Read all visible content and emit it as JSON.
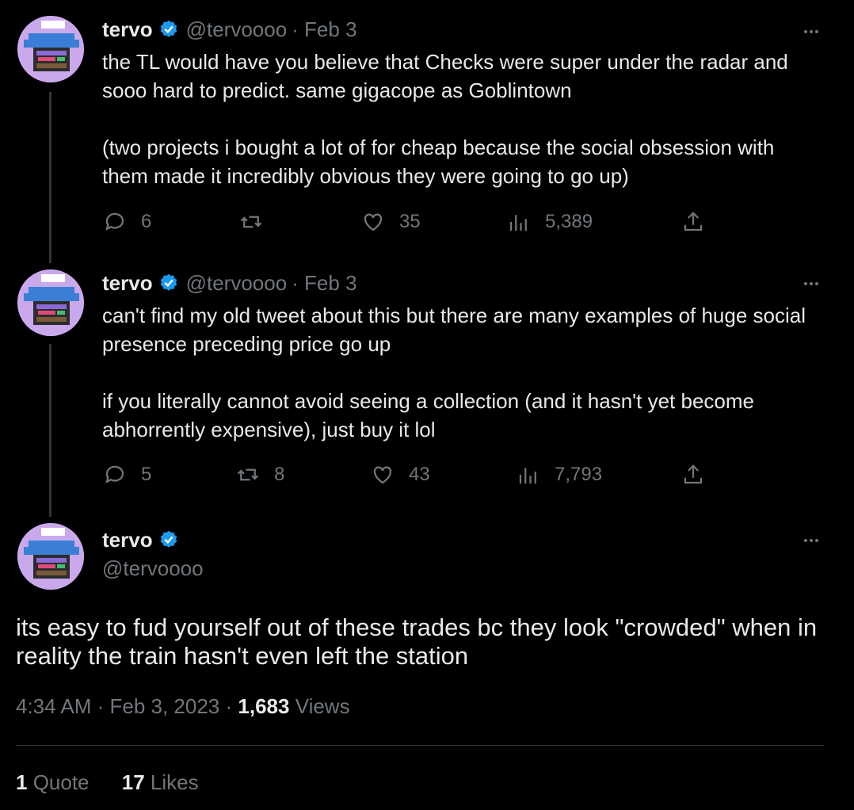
{
  "tweets": [
    {
      "name": "tervo",
      "handle": "@tervoooo",
      "date": "· Feb 3",
      "paragraphs": [
        "the TL would have you believe that Checks were super under the radar and sooo hard to predict. same gigacope as Goblintown",
        "(two projects i bought a lot of for cheap because the social obsession with them made it incredibly obvious they were going to go up)"
      ],
      "replies": "6",
      "retweets": "",
      "likes": "35",
      "views": "5,389"
    },
    {
      "name": "tervo",
      "handle": "@tervoooo",
      "date": "· Feb 3",
      "paragraphs": [
        "can't find my old tweet about this but there are many examples of huge social presence preceding price go up",
        "if you literally cannot avoid seeing a collection (and it hasn't yet become abhorrently expensive), just buy it lol"
      ],
      "replies": "5",
      "retweets": "8",
      "likes": "43",
      "views": "7,793"
    }
  ],
  "main": {
    "name": "tervo",
    "handle": "@tervoooo",
    "text": "its easy to fud yourself out of these trades bc they look \"crowded\" when in reality the train hasn't even left the station",
    "time": "4:34 AM · Feb 3, 2023 · ",
    "views_count": "1,683",
    "views_label": " Views",
    "quotes_count": "1",
    "quotes_label": " Quote",
    "likes_count": "17",
    "likes_label": " Likes"
  },
  "colors": {
    "background": "#000000",
    "text": "#e7e9ea",
    "muted": "#71767b",
    "verified": "#1d9bf0",
    "avatar_bg": "#c9a9ec"
  },
  "icons": [
    "reply-icon",
    "retweet-icon",
    "like-icon",
    "views-icon",
    "share-icon",
    "verified-badge-icon",
    "more-icon"
  ]
}
